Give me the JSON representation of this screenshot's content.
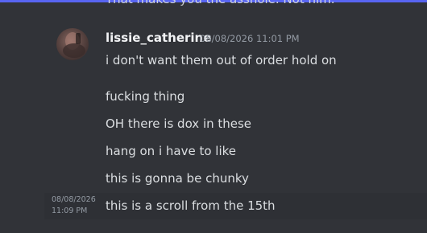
{
  "previous_message": {
    "text": "That makes you the asshole. Not him."
  },
  "author": {
    "username": "lissie_catherine",
    "timestamp": "08/08/2026 11:01 PM",
    "avatar_icon": "user-avatar-icon"
  },
  "messages": [
    {
      "text": "i don't want them out of order hold on"
    },
    {
      "text": "fucking thing"
    },
    {
      "text": "OH there is dox in these"
    },
    {
      "text": "hang on i have to like"
    },
    {
      "text": "this is gonna be chunky"
    },
    {
      "text": "this is a scroll from the 15th",
      "hover_date": "08/08/2026",
      "hover_time": "11:09 PM"
    }
  ],
  "colors": {
    "background": "#313338",
    "hover": "#2e3035",
    "accent": "#5865f2",
    "muted": "#949ba4"
  }
}
